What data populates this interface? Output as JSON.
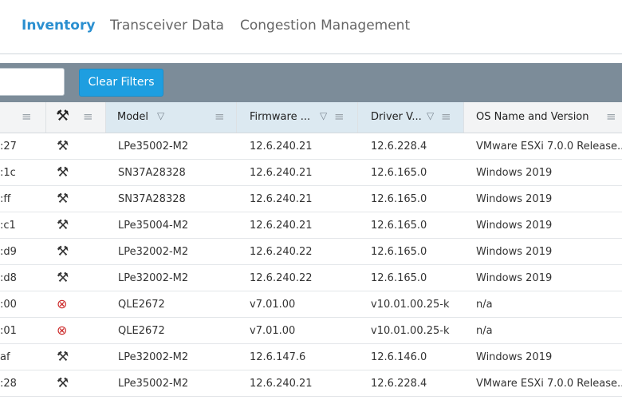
{
  "tabs": [
    {
      "label": "Inventory",
      "active": true
    },
    {
      "label": "Transceiver Data",
      "active": false
    },
    {
      "label": "Congestion Management",
      "active": false
    }
  ],
  "toolbar": {
    "search_value": "",
    "clear_filters_label": "Clear Filters"
  },
  "table": {
    "columns": [
      {
        "label": ""
      },
      {
        "label": ""
      },
      {
        "label": "Model"
      },
      {
        "label": "Firmware ..."
      },
      {
        "label": "Driver V..."
      },
      {
        "label": "OS Name and Version"
      }
    ],
    "rows": [
      {
        "id": ":27",
        "status": "ok",
        "model": "LPe35002-M2",
        "firmware": "12.6.240.21",
        "driver": "12.6.228.4",
        "os": "VMware ESXi 7.0.0 Release..."
      },
      {
        "id": ":1c",
        "status": "ok",
        "model": "SN37A28328",
        "firmware": "12.6.240.21",
        "driver": "12.6.165.0",
        "os": "Windows 2019"
      },
      {
        "id": ":ff",
        "status": "ok",
        "model": "SN37A28328",
        "firmware": "12.6.240.21",
        "driver": "12.6.165.0",
        "os": "Windows 2019"
      },
      {
        "id": ":c1",
        "status": "ok",
        "model": "LPe35004-M2",
        "firmware": "12.6.240.21",
        "driver": "12.6.165.0",
        "os": "Windows 2019"
      },
      {
        "id": ":d9",
        "status": "ok",
        "model": "LPe32002-M2",
        "firmware": "12.6.240.22",
        "driver": "12.6.165.0",
        "os": "Windows 2019"
      },
      {
        "id": ":d8",
        "status": "ok",
        "model": "LPe32002-M2",
        "firmware": "12.6.240.22",
        "driver": "12.6.165.0",
        "os": "Windows 2019"
      },
      {
        "id": ":00",
        "status": "error",
        "model": "QLE2672",
        "firmware": "v7.01.00",
        "driver": "v10.01.00.25-k",
        "os": "n/a"
      },
      {
        "id": ":01",
        "status": "error",
        "model": "QLE2672",
        "firmware": "v7.01.00",
        "driver": "v10.01.00.25-k",
        "os": "n/a"
      },
      {
        "id": "af",
        "status": "ok",
        "model": "LPe32002-M2",
        "firmware": "12.6.147.6",
        "driver": "12.6.146.0",
        "os": "Windows 2019"
      },
      {
        "id": ":28",
        "status": "ok",
        "model": "LPe35002-M2",
        "firmware": "12.6.240.21",
        "driver": "12.6.228.4",
        "os": "VMware ESXi 7.0.0 Release..."
      }
    ]
  },
  "icons": {
    "tools": "tools-icon",
    "tools_error": "tools-error-icon",
    "menu": "column-menu-icon",
    "filter": "filter-icon"
  },
  "colors": {
    "accent": "#2a8fd0",
    "button": "#1e9ee0",
    "toolbar": "#7c8c99",
    "error": "#cc2a2a"
  }
}
